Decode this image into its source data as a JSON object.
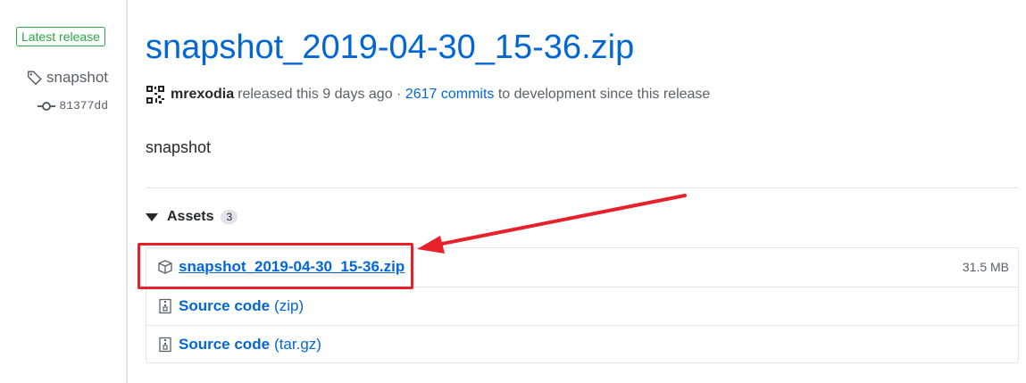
{
  "sidebar": {
    "latest_badge": "Latest release",
    "tag": "snapshot",
    "commit": "81377dd"
  },
  "release": {
    "title": "snapshot_2019-04-30_15-36.zip",
    "author": "mrexodia",
    "released_text": "released this 9 days ago ·",
    "commits_link": "2617 commits",
    "commits_suffix": "to development since this release",
    "body": "snapshot"
  },
  "assets": {
    "heading": "Assets",
    "count": "3",
    "items": [
      {
        "name": "snapshot_2019-04-30_15-36.zip",
        "size": "31.5 MB",
        "icon": "package-icon"
      },
      {
        "name": "Source code",
        "suffix": "(zip)",
        "icon": "zip-file-icon"
      },
      {
        "name": "Source code",
        "suffix": "(tar.gz)",
        "icon": "zip-file-icon"
      }
    ]
  },
  "colors": {
    "link": "#0366d6",
    "latest_green": "#28a745",
    "annotation_red": "#e8202a"
  }
}
